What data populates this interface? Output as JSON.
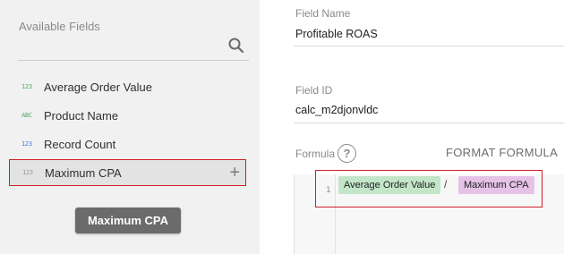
{
  "available_fields": {
    "title": "Available Fields",
    "items": [
      {
        "badge": "123",
        "label": "Average Order Value",
        "type": "number"
      },
      {
        "badge": "ABC",
        "label": "Product Name",
        "type": "text"
      },
      {
        "badge": "123",
        "label": "Record Count",
        "type": "number"
      },
      {
        "badge": "123",
        "label": "Maximum CPA",
        "type": "number",
        "selected": true
      }
    ],
    "plus_glyph": "+",
    "drag_chip_label": "Maximum CPA"
  },
  "field_name": {
    "label": "Field Name",
    "value": "Profitable ROAS"
  },
  "field_id": {
    "label": "Field ID",
    "value": "calc_m2djonvldc"
  },
  "formula": {
    "label": "Formula",
    "help_glyph": "?",
    "format_button": "FORMAT FORMULA",
    "line_number": "1",
    "tokens": {
      "left_field": "Average Order Value",
      "operator": "/",
      "right_field": "Maximum CPA"
    }
  },
  "colors": {
    "highlight_border": "#d21f2a",
    "chip_green": "#c3e6c8",
    "chip_purple": "#e6c2e6"
  }
}
